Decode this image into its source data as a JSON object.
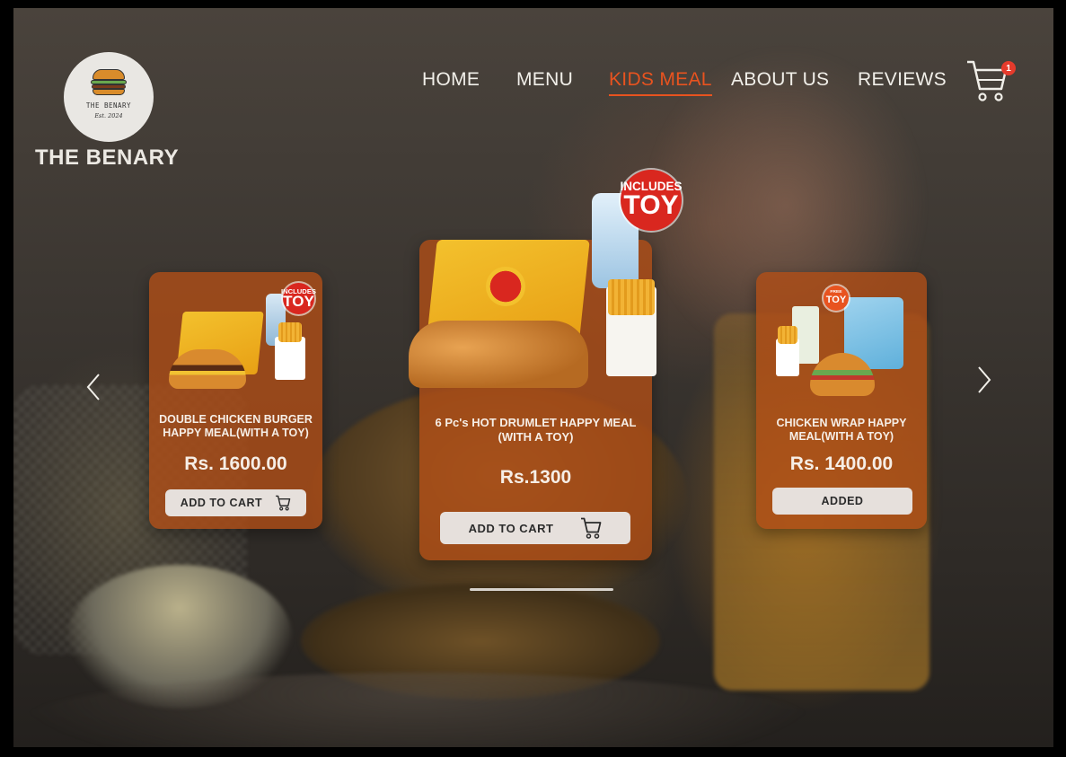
{
  "brand": {
    "logo_name": "THE BENARY",
    "logo_est": "Est. 2024",
    "title": "THE BENARY"
  },
  "nav": {
    "items": [
      {
        "label": "HOME",
        "active": false
      },
      {
        "label": "MENU",
        "active": false
      },
      {
        "label": "KIDS MEAL",
        "active": true
      },
      {
        "label": "ABOUT US",
        "active": false
      },
      {
        "label": "REVIEWS",
        "active": false
      }
    ],
    "cart_count": "1"
  },
  "carousel": {
    "cards": [
      {
        "badge_line1": "INCLUDES",
        "badge_line2": "TOY",
        "name": "DOUBLE CHICKEN BURGER HAPPY MEAL(WITH A TOY)",
        "price": "Rs. 1600.00",
        "button": "ADD TO CART"
      },
      {
        "badge_line1": "INCLUDES",
        "badge_line2": "TOY",
        "name": "6 Pc's HOT DRUMLET HAPPY MEAL (WITH A TOY)",
        "price": "Rs.1300",
        "button": "ADD TO CART"
      },
      {
        "badge_line1": "FREE",
        "badge_line2": "TOY",
        "name": "CHICKEN WRAP HAPPY MEAL(WITH A TOY)",
        "price": "Rs. 1400.00",
        "button": "ADDED"
      }
    ]
  },
  "colors": {
    "accent": "#e8531f",
    "card_bg": "#b24e16",
    "button_bg": "#e6e0dc",
    "badge": "#d9271f"
  },
  "icons": [
    "cart-icon",
    "chevron-left-icon",
    "chevron-right-icon"
  ]
}
